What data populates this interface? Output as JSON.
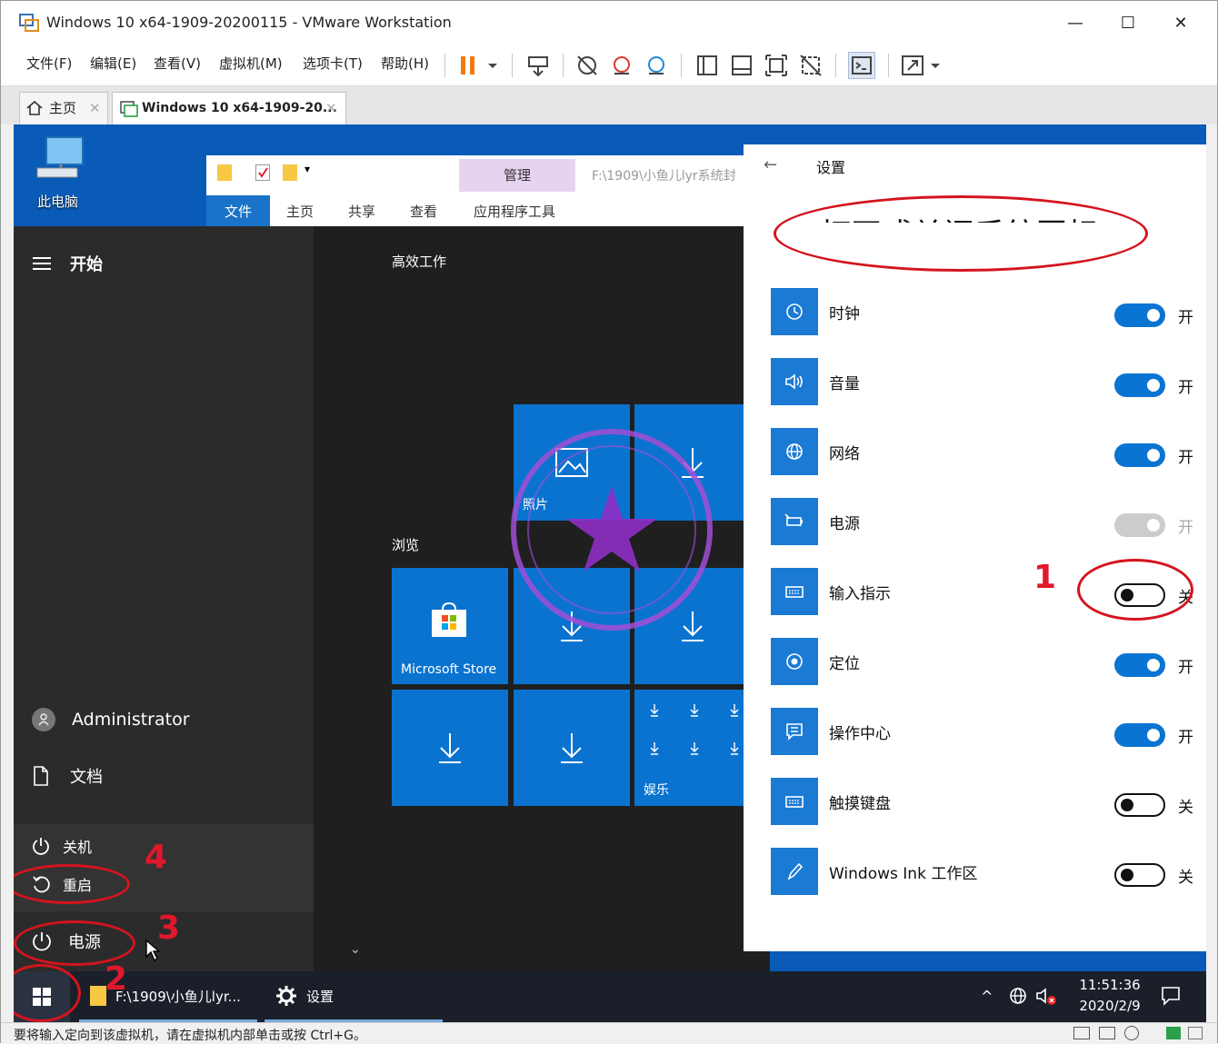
{
  "window": {
    "title": "Windows 10 x64-1909-20200115 - VMware Workstation",
    "minimize": "—",
    "maximize": "☐",
    "close": "✕"
  },
  "menubar": {
    "items": [
      "文件(F)",
      "编辑(E)",
      "查看(V)",
      "虚拟机(M)",
      "选项卡(T)",
      "帮助(H)"
    ]
  },
  "tabs": {
    "home": "主页",
    "vm": "Windows 10 x64-1909-20..."
  },
  "desktop": {
    "this_pc": "此电脑"
  },
  "explorer": {
    "manage": "管理",
    "path": "F:\\1909\\小鱼儿lyr系统封",
    "ribbon_tabs": [
      "文件",
      "主页",
      "共享",
      "查看",
      "应用程序工具"
    ]
  },
  "start_menu": {
    "title": "开始",
    "user": "Administrator",
    "documents": "文档",
    "shutdown": "关机",
    "restart": "重启",
    "power": "电源",
    "group_productive": "高效工作",
    "group_browse": "浏览",
    "tiles": {
      "photos": "照片",
      "store": "Microsoft Store",
      "entertainment": "娱乐"
    }
  },
  "settings": {
    "back": "←",
    "app_title": "设置",
    "heading": "打开或关闭系统图标",
    "items": [
      {
        "label": "时钟",
        "state": "开",
        "toggle": "on"
      },
      {
        "label": "音量",
        "state": "开",
        "toggle": "on"
      },
      {
        "label": "网络",
        "state": "开",
        "toggle": "on"
      },
      {
        "label": "电源",
        "state": "开",
        "toggle": "disabled"
      },
      {
        "label": "输入指示",
        "state": "关",
        "toggle": "off"
      },
      {
        "label": "定位",
        "state": "开",
        "toggle": "on"
      },
      {
        "label": "操作中心",
        "state": "开",
        "toggle": "on"
      },
      {
        "label": "触摸键盘",
        "state": "关",
        "toggle": "off"
      },
      {
        "label": "Windows Ink 工作区",
        "state": "关",
        "toggle": "off"
      }
    ]
  },
  "taskbar": {
    "explorer_item": "F:\\1909\\小鱼儿lyr...",
    "settings_item": "设置",
    "time": "11:51:36",
    "date": "2020/2/9"
  },
  "statusbar": {
    "message": "要将输入定向到该虚拟机，请在虚拟机内部单击或按 Ctrl+G。"
  },
  "annotations": {
    "n1": "1",
    "n2": "2",
    "n3": "3",
    "n4": "4"
  },
  "colors": {
    "accent": "#0a74d2",
    "annotation": "#d4141e",
    "desktop": "#0a5bb8",
    "tile": "#0a73cf"
  }
}
